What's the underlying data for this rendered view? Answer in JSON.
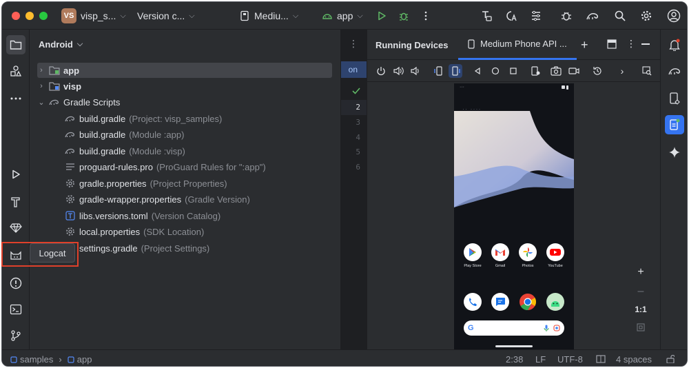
{
  "titlebar": {
    "project_badge": "VS",
    "project_name": "visp_s...",
    "vcs_label": "Version c...",
    "device_label": "Mediu...",
    "run_config": "app"
  },
  "project_panel": {
    "view_selector": "Android",
    "tree": [
      {
        "name": "app",
        "hint": "",
        "icon": "module-icon",
        "expanded": false,
        "selected": true
      },
      {
        "name": "visp",
        "hint": "",
        "icon": "module-lib-icon",
        "expanded": false,
        "selected": false
      },
      {
        "name": "Gradle Scripts",
        "hint": "",
        "icon": "gradle-icon",
        "expanded": true,
        "selected": false
      },
      {
        "name": "build.gradle",
        "hint": "(Project: visp_samples)",
        "icon": "gradle-icon"
      },
      {
        "name": "build.gradle",
        "hint": "(Module :app)",
        "icon": "gradle-icon"
      },
      {
        "name": "build.gradle",
        "hint": "(Module :visp)",
        "icon": "gradle-icon"
      },
      {
        "name": "proguard-rules.pro",
        "hint": "(ProGuard Rules for \":app\")",
        "icon": "text-lines-icon"
      },
      {
        "name": "gradle.properties",
        "hint": "(Project Properties)",
        "icon": "gear-icon"
      },
      {
        "name": "gradle-wrapper.properties",
        "hint": "(Gradle Version)",
        "icon": "gear-icon"
      },
      {
        "name": "libs.versions.toml",
        "hint": "(Version Catalog)",
        "icon": "toml-icon"
      },
      {
        "name": "local.properties",
        "hint": "(SDK Location)",
        "icon": "gear-icon"
      },
      {
        "name": "settings.gradle",
        "hint": "(Project Settings)",
        "icon": "gradle-icon"
      }
    ]
  },
  "editor": {
    "tab_fragment": "on",
    "line_numbers": [
      "2",
      "3",
      "4",
      "5",
      "6"
    ]
  },
  "running_devices": {
    "title": "Running Devices",
    "tab_label": "Medium Phone API ...",
    "phone": {
      "apps_row1": [
        "Play Store",
        "Gmail",
        "Photos",
        "YouTube"
      ],
      "zoom_ratio": "1:1"
    }
  },
  "tooltip": {
    "label": "Logcat"
  },
  "statusbar": {
    "breadcrumb_root": "samples",
    "breadcrumb_leaf": "app",
    "cursor_position": "2:38",
    "line_ending": "LF",
    "encoding": "UTF-8",
    "indent": "4 spaces"
  },
  "colors": {
    "accent": "#3574f0",
    "highlight": "#e0402a",
    "background": "#2b2d30"
  }
}
